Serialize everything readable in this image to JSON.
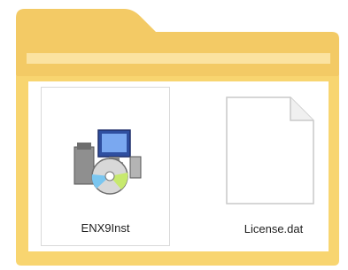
{
  "folder": {
    "icon_name": "folder-icon",
    "colors": {
      "back": "#f3ca65",
      "front": "#f8d570",
      "stripe": "#fbe3a1",
      "paper": "#ffffff"
    }
  },
  "files": [
    {
      "name": "ENX9Inst",
      "icon": "installer-exe-icon",
      "selected": true
    },
    {
      "name": "License.dat",
      "icon": "generic-file-icon",
      "selected": false
    }
  ]
}
